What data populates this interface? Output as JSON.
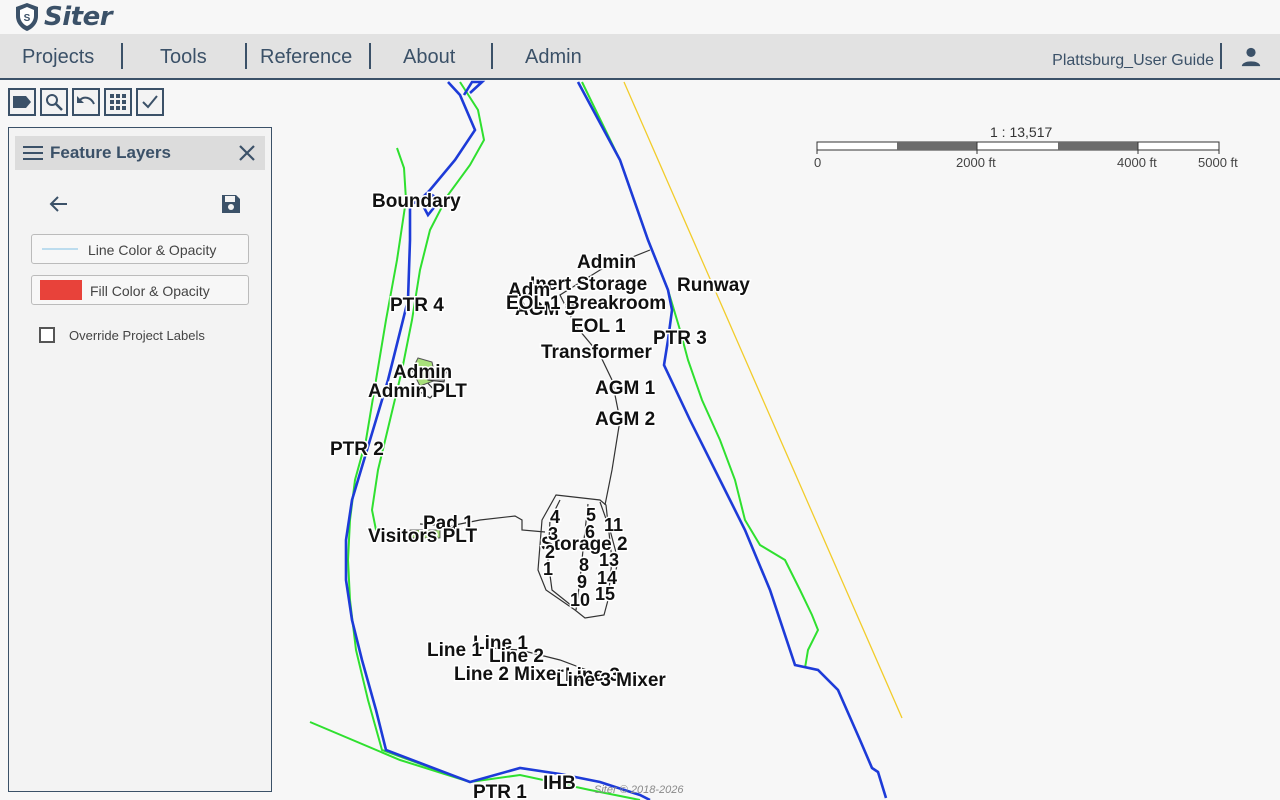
{
  "app": {
    "name": "Siter"
  },
  "nav": {
    "items": [
      "Projects",
      "Tools",
      "Reference",
      "About",
      "Admin"
    ],
    "user_guide": "Plattsburg_User Guide"
  },
  "toolbar": {
    "icons": [
      "label-icon",
      "search-icon",
      "undo-icon",
      "grid-icon",
      "check-icon"
    ]
  },
  "panel": {
    "title": "Feature Layers",
    "line_option": "Line Color & Opacity",
    "fill_option": "Fill Color & Opacity",
    "override_label": "Override Project Labels",
    "override_checked": false
  },
  "scale": {
    "ratio": "1 : 13,517",
    "ticks": [
      "0",
      "2000 ft",
      "4000 ft",
      "5000 ft"
    ]
  },
  "map": {
    "labels": {
      "boundary": "Boundary",
      "ptr4": "PTR 4",
      "ptr3": "PTR 3",
      "ptr2": "PTR 2",
      "ptr1": "PTR 1",
      "admin_a": "Admin",
      "inert_storage": "Inert Storage",
      "runway": "Runway",
      "admin_b": "Adm",
      "eol1_breakroom": "EOL 1 Breakroom",
      "agm_partial": "AGM 3",
      "eol1": "EOL 1",
      "transformer": "Transformer",
      "admin_c": "Admin",
      "admin_plt": "Admin PLT",
      "agm1": "AGM 1",
      "agm2": "AGM 2",
      "pad1": "Pad 1",
      "visitors_plt": "Visitors PLT",
      "storage2": "Storage 2",
      "line1_a": "Line 1",
      "line1_b": "Line 1",
      "line2": "Line 2",
      "line2_mixer": "Line 2 Mixer",
      "line3": "Line 3",
      "line3_mixer": "Line 3 Mixer",
      "ihb": "IHB",
      "m1": "1",
      "m2": "2",
      "m3": "3",
      "m4": "4",
      "m5": "5",
      "m6": "6",
      "m8": "8",
      "m9": "9",
      "m10": "10",
      "m11": "11",
      "m13": "13",
      "m14": "14",
      "m15": "15"
    },
    "colors": {
      "boundary_blue": "#1d3bd8",
      "green_line": "#2fe02f",
      "runway_yellow": "#f2cc2a",
      "roads": "#333333"
    }
  },
  "copyright": "Siter © 2018-2026"
}
